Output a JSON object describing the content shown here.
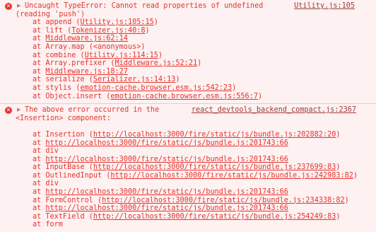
{
  "error1": {
    "icon": "error-circle-icon",
    "message_line1": "Uncaught TypeError: Cannot read properties of undefined",
    "message_line2": "(reading 'push')",
    "source": "Utility.js:105",
    "frames": [
      {
        "name": "append",
        "loc": "Utility.js:105:15"
      },
      {
        "name": "lift",
        "loc": "Tokenizer.js:40:8"
      },
      {
        "name": "",
        "loc": "Middleware.js:62:14"
      },
      {
        "name": "Array.map",
        "loc": "<anonymous>",
        "plain": true
      },
      {
        "name": "combine",
        "loc": "Utility.js:114:15"
      },
      {
        "name": "Array.prefixer",
        "loc": "Middleware.js:52:21"
      },
      {
        "name": "",
        "loc": "Middleware.js:18:27"
      },
      {
        "name": "serialize",
        "loc": "Serializer.js:14:13"
      },
      {
        "name": "stylis",
        "loc": "emotion-cache.browser.esm.js:542:23"
      },
      {
        "name": "Object.insert",
        "loc": "emotion-cache.browser.esm.js:556:7"
      }
    ]
  },
  "error2": {
    "icon": "error-circle-icon",
    "message_line1": "The above error occurred in the",
    "message_line2": "<Insertion> component:",
    "source": "react_devtools_backend_compact.js:2367",
    "frames": [
      {
        "name": "Insertion",
        "loc": "http://localhost:3000/fire/static/js/bundle.js:202882:20"
      },
      {
        "name": "",
        "loc": "http://localhost:3000/fire/static/js/bundle.js:201743:66"
      },
      {
        "name": "div",
        "loc": null
      },
      {
        "name": "",
        "loc": "http://localhost:3000/fire/static/js/bundle.js:201743:66"
      },
      {
        "name": "InputBase",
        "loc": "http://localhost:3000/fire/static/js/bundle.js:237699:83"
      },
      {
        "name": "OutlinedInput",
        "loc": "http://localhost:3000/fire/static/js/bundle.js:242983:82"
      },
      {
        "name": "div",
        "loc": null
      },
      {
        "name": "",
        "loc": "http://localhost:3000/fire/static/js/bundle.js:201743:66"
      },
      {
        "name": "FormControl",
        "loc": "http://localhost:3000/fire/static/js/bundle.js:234338:82"
      },
      {
        "name": "",
        "loc": "http://localhost:3000/fire/static/js/bundle.js:201743:66"
      },
      {
        "name": "TextField",
        "loc": "http://localhost:3000/fire/static/js/bundle.js:254249:83"
      },
      {
        "name": "form",
        "loc": null
      }
    ]
  }
}
